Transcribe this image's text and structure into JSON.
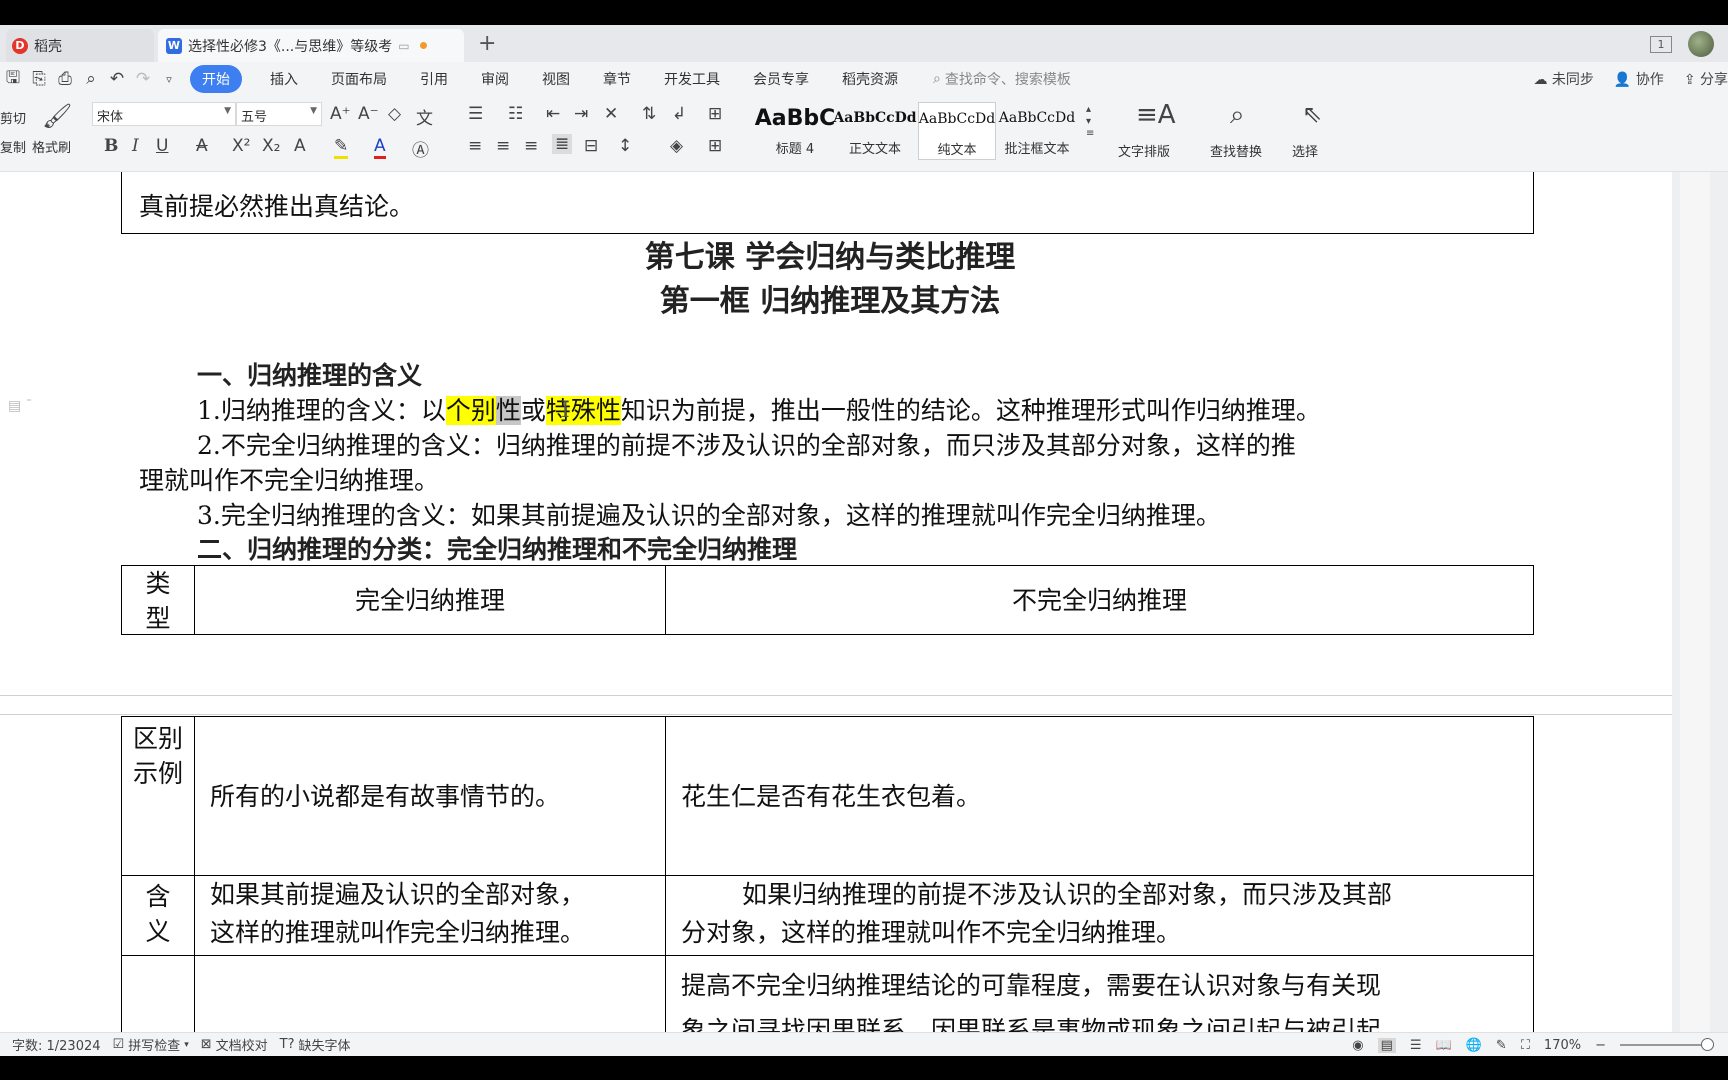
{
  "tabs": {
    "home_label": "稻壳",
    "doc_label": "选择性必修3《...与思维》等级考",
    "page_indicator": "1"
  },
  "menu": {
    "start": "开始",
    "items": [
      "插入",
      "页面布局",
      "引用",
      "审阅",
      "视图",
      "章节",
      "开发工具",
      "会员专享",
      "稻壳资源"
    ],
    "search_placeholder": "查找命令、搜索模板",
    "sync": "未同步",
    "collab": "协作",
    "share": "分享"
  },
  "ribbon": {
    "cut": "剪切",
    "copy": "复制",
    "format_painter": "格式刷",
    "font_name": "宋体",
    "font_size": "五号",
    "styles": [
      {
        "preview": "AaBbC",
        "label": "标题 4"
      },
      {
        "preview": "AaBbCcDd",
        "label": "正文文本"
      },
      {
        "preview": "AaBbCcDd",
        "label": "纯文本"
      },
      {
        "preview": "AaBbCcDd",
        "label": "批注框文本"
      }
    ],
    "text_layout": "文字排版",
    "find_replace": "查找替换",
    "select": "选择"
  },
  "document": {
    "top_box_text": "真前提必然推出真结论。",
    "lesson_title": "第七课  学会归纳与类比推理",
    "frame_title": "第一框    归纳推理及其方法",
    "section1": "一、归纳推理的含义",
    "p1_prefix": "1.归纳推理的含义：以",
    "p1_hl1": "个别",
    "p1_sel": "性",
    "p1_mid": "或",
    "p1_hl2": "特殊性",
    "p1_suffix": "知识为前提，推出一般性的结论。这种推理形式叫作归纳推理。",
    "p2_line1": "2.不完全归纳推理的含义：归纳推理的前提不涉及认识的全部对象，而只涉及其部分对象，这样的推",
    "p2_line2": "理就叫作不完全归纳推理。",
    "p3": "3.完全归纳推理的含义：如果其前提遍及认识的全部对象，这样的推理就叫作完全归纳推理。",
    "section2": "二、归纳推理的分类：完全归纳推理和不完全归纳推理",
    "table": {
      "header_type": "类型",
      "header_complete": "完全归纳推理",
      "header_incomplete": "不完全归纳推理",
      "row_example_label": "区别示例",
      "row_example_complete": "所有的小说都是有故事情节的。",
      "row_example_incomplete": "花生仁是否有花生衣包着。",
      "row_meaning_label": "含义",
      "row_meaning_complete_l1": "如果其前提遍及认识的全部对象，",
      "row_meaning_complete_l2": "这样的推理就叫作完全归纳推理。",
      "row_meaning_incomplete_l1": "如果归纳推理的前提不涉及认识的全部对象，而只涉及其部",
      "row_meaning_incomplete_l2": "分对象，这样的推理就叫作不完全归纳推理。",
      "row_last_incomplete_l1": "提高不完全归纳推理结论的可靠程度，需要在认识对象与有关现",
      "row_last_incomplete_l2": "象之间寻找因果联系。因果联系是事物或现象之间引起与被引起"
    }
  },
  "status": {
    "word_count": "字数: 1/23024",
    "spell_check": "拼写检查",
    "doc_proof": "文档校对",
    "missing_font": "缺失字体",
    "zoom": "170%"
  }
}
